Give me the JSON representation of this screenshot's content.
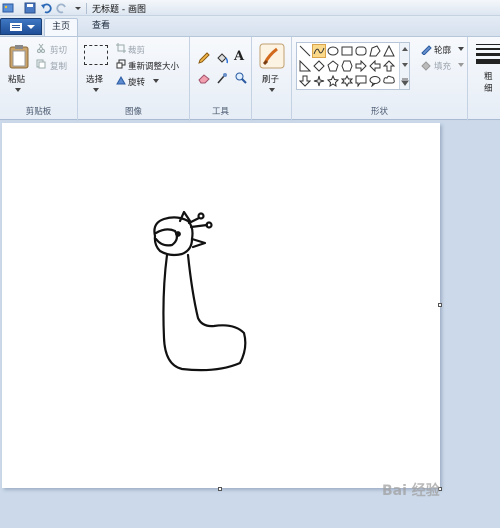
{
  "window": {
    "title": "无标题 - 画图"
  },
  "tabs": [
    {
      "label": "主页"
    },
    {
      "label": "查看"
    }
  ],
  "ribbon": {
    "clipboard": {
      "paste": "粘贴",
      "cut": "剪切",
      "copy": "复制",
      "label": "剪贴板"
    },
    "image": {
      "select": "选择",
      "crop": "裁剪",
      "resize": "重新调整大小",
      "rotate": "旋转",
      "label": "图像"
    },
    "tools": {
      "label": "工具"
    },
    "brushes": {
      "label": "刷子"
    },
    "shapes": {
      "outline": "轮廓",
      "fill": "填充",
      "label": "形状"
    },
    "size": {
      "label": "粗细"
    }
  },
  "watermark": {
    "text": "Bai 经验"
  },
  "colors": {
    "accent": "#1e4e96",
    "selected_shape": "#fbd98a",
    "canvas": "#ffffff",
    "workspace": "#cbd9ea"
  }
}
